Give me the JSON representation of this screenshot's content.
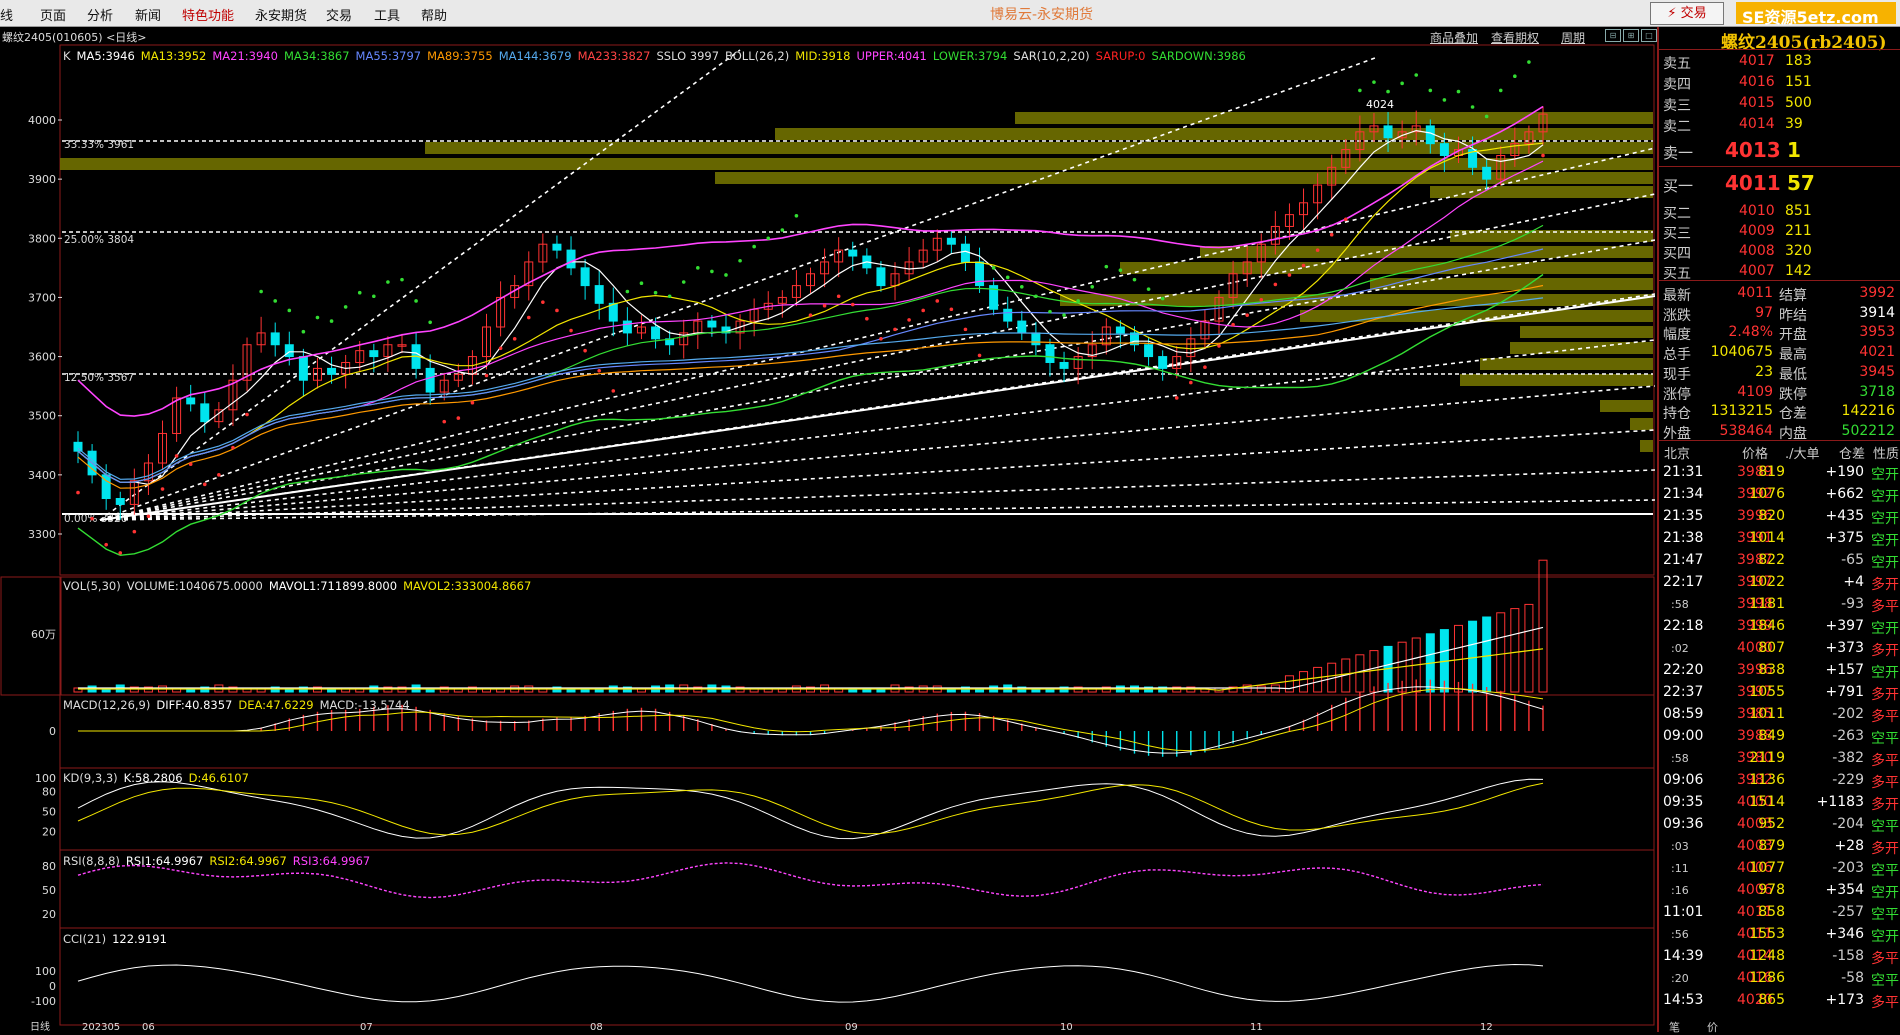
{
  "menu": {
    "items": [
      "线",
      "页面",
      "分析",
      "新闻",
      "特色功能",
      "永安期货",
      "交易",
      "工具",
      "帮助"
    ],
    "app_title": "博易云-永安期货",
    "trade_button": "⚡ 交易",
    "watermark": "SE资源5etz.com"
  },
  "subbar": {
    "symbol": "螺纹2405(010605)  <日线>",
    "links": [
      "商品叠加",
      "查看期权",
      "周期"
    ]
  },
  "main_panel": {
    "indicators": [
      {
        "text": "K",
        "color": "#dddddd"
      },
      {
        "text": "MA5:3946",
        "color": "#ffffff"
      },
      {
        "text": "MA13:3952",
        "color": "#f2e600"
      },
      {
        "text": "MA21:3940",
        "color": "#ff44ff"
      },
      {
        "text": "MA34:3867",
        "color": "#33dd33"
      },
      {
        "text": "MA55:3797",
        "color": "#6688ff"
      },
      {
        "text": "MA89:3755",
        "color": "#ff9900"
      },
      {
        "text": "MA144:3679",
        "color": "#55aaee"
      },
      {
        "text": "MA233:3827",
        "color": "#ff4444"
      },
      {
        "text": "SSLO 3997",
        "color": "#dddddd"
      },
      {
        "text": "BOLL(26,2)",
        "color": "#dddddd"
      },
      {
        "text": "MID:3918",
        "color": "#f2e600"
      },
      {
        "text": "UPPER:4041",
        "color": "#ff44ff"
      },
      {
        "text": "LOWER:3794",
        "color": "#33dd33"
      },
      {
        "text": "SAR(10,2,20)",
        "color": "#dddddd"
      },
      {
        "text": "SARUP:0",
        "color": "#ff2222"
      },
      {
        "text": "SARDOWN:3986",
        "color": "#33dd33"
      }
    ],
    "y_ticks": [
      "4000",
      "3900",
      "3800",
      "3700",
      "3600",
      "3500",
      "3400",
      "3300"
    ],
    "fib_labels": [
      "33.33%  3961",
      "25.00%  3804",
      "12.50%  3567",
      "0.00%  3320"
    ],
    "high_label": "4024",
    "x_ticks": [
      "日线",
      "202305",
      "06",
      "07",
      "08",
      "09",
      "10",
      "11",
      "12"
    ]
  },
  "vol_panel": {
    "indicators": [
      {
        "text": "VOL(5,30)",
        "color": "#dddddd"
      },
      {
        "text": "VOLUME:1040675.0000",
        "color": "#dddddd"
      },
      {
        "text": "MAVOL1:711899.8000",
        "color": "#ffffff"
      },
      {
        "text": "MAVOL2:333004.8667",
        "color": "#f2e600"
      }
    ],
    "y_tick": "60万"
  },
  "macd_panel": {
    "indicators": [
      {
        "text": "MACD(12,26,9)",
        "color": "#dddddd"
      },
      {
        "text": "DIFF:40.8357",
        "color": "#ffffff"
      },
      {
        "text": "DEA:47.6229",
        "color": "#f2e600"
      },
      {
        "text": "MACD:-13.5744",
        "color": "#dddddd"
      }
    ],
    "y_tick": "0"
  },
  "kd_panel": {
    "indicators": [
      {
        "text": "KD(9,3,3)",
        "color": "#dddddd"
      },
      {
        "text": "K:58.2806",
        "color": "#ffffff"
      },
      {
        "text": "D:46.6107",
        "color": "#f2e600"
      }
    ],
    "y_ticks": [
      "100",
      "80",
      "50",
      "20"
    ]
  },
  "rsi_panel": {
    "indicators": [
      {
        "text": "RSI(8,8,8)",
        "color": "#dddddd"
      },
      {
        "text": "RSI1:64.9967",
        "color": "#ffffff"
      },
      {
        "text": "RSI2:64.9967",
        "color": "#f2e600"
      },
      {
        "text": "RSI3:64.9967",
        "color": "#ff44ff"
      }
    ],
    "y_ticks": [
      "80",
      "50",
      "20"
    ]
  },
  "cci_panel": {
    "indicators": [
      {
        "text": "CCI(21)",
        "color": "#dddddd"
      },
      {
        "text": "122.9191",
        "color": "#ffffff"
      }
    ],
    "y_ticks": [
      "100",
      "0",
      "-100"
    ]
  },
  "quote": {
    "title": "螺纹2405(rb2405)",
    "asks": [
      {
        "label": "卖五",
        "price": "4017",
        "vol": "183"
      },
      {
        "label": "卖四",
        "price": "4016",
        "vol": "151"
      },
      {
        "label": "卖三",
        "price": "4015",
        "vol": "500"
      },
      {
        "label": "卖二",
        "price": "4014",
        "vol": "39"
      },
      {
        "label": "卖一",
        "price": "4013",
        "vol": "1"
      }
    ],
    "bids": [
      {
        "label": "买一",
        "price": "4011",
        "vol": "57"
      },
      {
        "label": "买二",
        "price": "4010",
        "vol": "851"
      },
      {
        "label": "买三",
        "price": "4009",
        "vol": "211"
      },
      {
        "label": "买四",
        "price": "4008",
        "vol": "320"
      },
      {
        "label": "买五",
        "price": "4007",
        "vol": "142"
      }
    ],
    "stats": [
      {
        "l1": "最新",
        "v1": "4011",
        "c1": "#ff3333",
        "l2": "结算",
        "v2": "3992",
        "c2": "#ff3333"
      },
      {
        "l1": "涨跌",
        "v1": "97",
        "c1": "#ff3333",
        "l2": "昨结",
        "v2": "3914",
        "c2": "#ffffff"
      },
      {
        "l1": "幅度",
        "v1": "2.48%",
        "c1": "#ff3333",
        "l2": "开盘",
        "v2": "3953",
        "c2": "#ff3333"
      },
      {
        "l1": "总手",
        "v1": "1040675",
        "c1": "#f2e600",
        "l2": "最高",
        "v2": "4021",
        "c2": "#ff3333"
      },
      {
        "l1": "现手",
        "v1": "23",
        "c1": "#f2e600",
        "l2": "最低",
        "v2": "3945",
        "c2": "#ff3333"
      },
      {
        "l1": "涨停",
        "v1": "4109",
        "c1": "#ff3333",
        "l2": "跌停",
        "v2": "3718",
        "c2": "#33dd33"
      },
      {
        "l1": "持仓",
        "v1": "1313215",
        "c1": "#f2e600",
        "l2": "仓差",
        "v2": "142216",
        "c2": "#f2e600"
      },
      {
        "l1": "外盘",
        "v1": "538464",
        "c1": "#ff3333",
        "l2": "内盘",
        "v2": "502212",
        "c2": "#33dd33"
      }
    ],
    "ticks_header": [
      "北京",
      "价格",
      "./大单",
      "仓差",
      "性质"
    ],
    "ticks": [
      {
        "time": "21:31",
        "price": "3989",
        "vol": "819",
        "oi": "+190",
        "type": "空开"
      },
      {
        "time": "21:34",
        "price": "3992",
        "vol": "1076",
        "oi": "+662",
        "type": "空开"
      },
      {
        "time": "21:35",
        "price": "3996",
        "vol": "820",
        "oi": "+435",
        "type": "空开"
      },
      {
        "time": "21:38",
        "price": "3991",
        "vol": "1014",
        "oi": "+375",
        "type": "空开"
      },
      {
        "time": "21:47",
        "price": "3987",
        "vol": "822",
        "oi": "-65",
        "type": "空开"
      },
      {
        "time": "22:17",
        "price": "3997",
        "vol": "1022",
        "oi": "+4",
        "type": "多开"
      },
      {
        "time": ":58",
        "price": "3998",
        "vol": "1181",
        "oi": "-93",
        "type": "多平"
      },
      {
        "time": "22:18",
        "price": "3999",
        "vol": "1846",
        "oi": "+397",
        "type": "空开"
      },
      {
        "time": ":02",
        "price": "4000",
        "vol": "807",
        "oi": "+373",
        "type": "多开"
      },
      {
        "time": "22:20",
        "price": "3996",
        "vol": "838",
        "oi": "+157",
        "type": "空开"
      },
      {
        "time": "22:37",
        "price": "3997",
        "vol": "1055",
        "oi": "+791",
        "type": "多开"
      },
      {
        "time": "08:59",
        "price": "3985",
        "vol": "1011",
        "oi": "-202",
        "type": "多平"
      },
      {
        "time": "09:00",
        "price": "3988",
        "vol": "849",
        "oi": "-263",
        "type": "空平"
      },
      {
        "time": ":58",
        "price": "3980",
        "vol": "2119",
        "oi": "-382",
        "type": "多平"
      },
      {
        "time": "09:06",
        "price": "3982",
        "vol": "1136",
        "oi": "-229",
        "type": "多平"
      },
      {
        "time": "09:35",
        "price": "4000",
        "vol": "1514",
        "oi": "+1183",
        "type": "多开"
      },
      {
        "time": "09:36",
        "price": "4003",
        "vol": "952",
        "oi": "-204",
        "type": "空平"
      },
      {
        "time": ":03",
        "price": "4003",
        "vol": "879",
        "oi": "+28",
        "type": "多开"
      },
      {
        "time": ":11",
        "price": "4006",
        "vol": "1077",
        "oi": "-203",
        "type": "空平"
      },
      {
        "time": ":16",
        "price": "4006",
        "vol": "978",
        "oi": "+354",
        "type": "空开"
      },
      {
        "time": "11:01",
        "price": "4011",
        "vol": "858",
        "oi": "-257",
        "type": "空平"
      },
      {
        "time": ":56",
        "price": "4011",
        "vol": "1553",
        "oi": "+346",
        "type": "空开"
      },
      {
        "time": "14:39",
        "price": "4014",
        "vol": "1248",
        "oi": "-158",
        "type": "多平"
      },
      {
        "time": ":20",
        "price": "4016",
        "vol": "1286",
        "oi": "-58",
        "type": "空平"
      },
      {
        "time": "14:53",
        "price": "4020",
        "vol": "865",
        "oi": "+173",
        "type": "多平"
      }
    ],
    "bottom_tabs": [
      "笔",
      "价"
    ]
  },
  "colors": {
    "up": "#ff3333",
    "down": "#00e5ee",
    "grid": "#8b1a1a",
    "fib_band": "#6b6b00",
    "label_gray": "#cccccc"
  },
  "chart_data": {
    "type": "candlestick",
    "series_desc": "daily OHLC rebar rb2405",
    "x": [
      "202305",
      "06",
      "07",
      "08",
      "09",
      "10",
      "11",
      "12"
    ],
    "ylim": [
      3300,
      4060
    ],
    "close": [
      3440,
      3400,
      3360,
      3350,
      3390,
      3420,
      3470,
      3530,
      3520,
      3490,
      3510,
      3560,
      3620,
      3640,
      3620,
      3600,
      3560,
      3580,
      3570,
      3590,
      3610,
      3600,
      3620,
      3620,
      3580,
      3540,
      3560,
      3570,
      3600,
      3650,
      3700,
      3720,
      3760,
      3790,
      3780,
      3750,
      3720,
      3690,
      3660,
      3640,
      3650,
      3630,
      3620,
      3640,
      3660,
      3650,
      3640,
      3660,
      3680,
      3690,
      3700,
      3720,
      3740,
      3760,
      3780,
      3770,
      3750,
      3720,
      3740,
      3760,
      3780,
      3800,
      3790,
      3760,
      3720,
      3680,
      3660,
      3640,
      3620,
      3590,
      3580,
      3600,
      3620,
      3650,
      3640,
      3620,
      3600,
      3580,
      3600,
      3630,
      3660,
      3700,
      3740,
      3760,
      3790,
      3820,
      3840,
      3860,
      3890,
      3920,
      3950,
      3980,
      3990,
      3970,
      3980,
      3990,
      3960,
      3940,
      3950,
      3920,
      3900,
      3940,
      3960,
      3980,
      4010
    ],
    "macd": {
      "diff": 40.8357,
      "dea": 47.6229,
      "hist": -13.5744
    },
    "kd": {
      "k": 58.2806,
      "d": 46.6107
    },
    "rsi": 64.9967,
    "cci": 122.9191,
    "volume_last": 1040675
  }
}
